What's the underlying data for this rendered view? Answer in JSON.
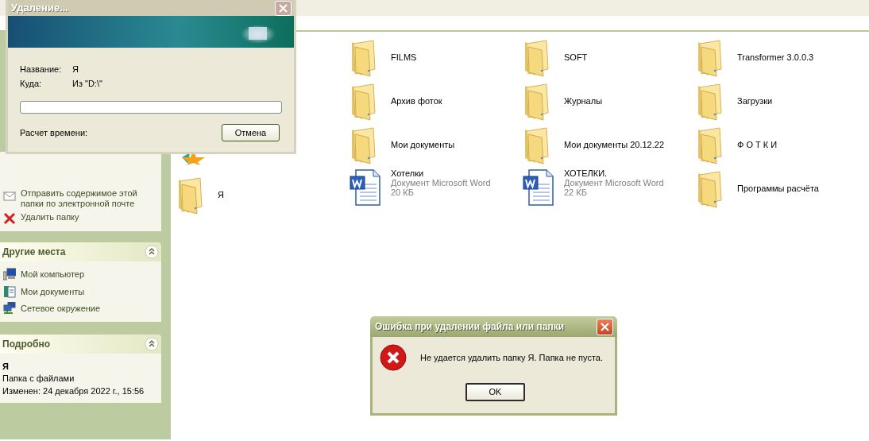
{
  "sidebar": {
    "file_tasks": [
      {
        "kind": "email",
        "label": "Отправить содержимое этой папки по электронной почте"
      },
      {
        "kind": "delete",
        "label": "Удалить папку"
      }
    ],
    "other_places": {
      "title": "Другие места",
      "items": [
        {
          "kind": "computer",
          "label": "Мой компьютер"
        },
        {
          "kind": "documents",
          "label": "Мои документы"
        },
        {
          "kind": "network",
          "label": "Сетевое окружение"
        }
      ]
    },
    "details": {
      "title": "Подробно",
      "name": "Я",
      "type": "Папка с файлами",
      "modified": "Изменен: 24 декабря 2022 г., 15:56"
    }
  },
  "columns": [
    [
      {
        "kind": "shortcut"
      },
      {
        "kind": "folder",
        "name": "Я"
      }
    ],
    [
      {
        "kind": "folder",
        "name": "FILMS"
      },
      {
        "kind": "folder",
        "name": "Архив фоток"
      },
      {
        "kind": "folder",
        "name": "Мои документы"
      },
      {
        "kind": "document",
        "name": "Хотелки",
        "type": "Документ Microsoft Word",
        "size": "20 КБ"
      }
    ],
    [
      {
        "kind": "folder",
        "name": "SOFT"
      },
      {
        "kind": "folder",
        "name": "Журналы"
      },
      {
        "kind": "folder",
        "name": "Мои документы 20.12.22"
      },
      {
        "kind": "document",
        "name": "ХОТЕЛКИ.",
        "type": "Документ Microsoft Word",
        "size": "22 КБ"
      }
    ],
    [
      {
        "kind": "folder",
        "name": "Transformer 3.0.0.3"
      },
      {
        "kind": "folder",
        "name": "Загрузки"
      },
      {
        "kind": "folder",
        "name": "Ф О Т К И"
      },
      {
        "kind": "folder",
        "name": "Программы расчёта"
      }
    ]
  ],
  "delete_dialog": {
    "title": "Удаление...",
    "name_label": "Название:",
    "name_value": "Я",
    "dest_label": "Куда:",
    "dest_value": "Из \"D:\\\"",
    "progress": {
      "level": 0
    },
    "time_label": "Расчет времени:",
    "cancel": "Отмена"
  },
  "error_dialog": {
    "title": "Ошибка при удалении файла или папки",
    "message": "Не удается удалить папку Я. Папка не пуста.",
    "ok": "OK"
  }
}
